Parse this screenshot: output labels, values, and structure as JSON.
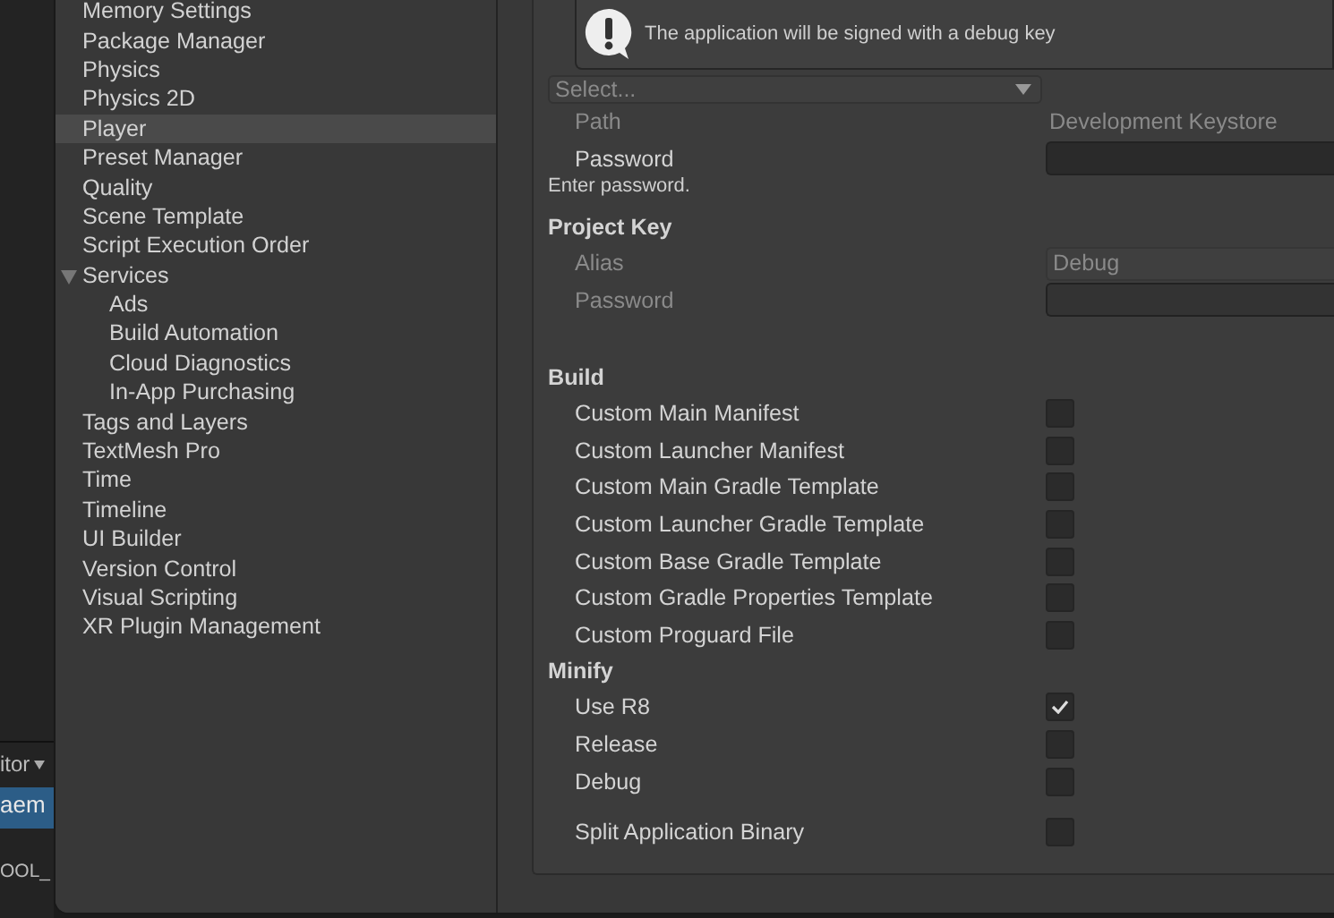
{
  "background_editor": {
    "dropdown_label": "itor",
    "selected_item": "aem",
    "item": "OOL_"
  },
  "sidebar": {
    "items": [
      {
        "label": "Memory Settings",
        "selected": false
      },
      {
        "label": "Package Manager",
        "selected": false
      },
      {
        "label": "Physics",
        "selected": false
      },
      {
        "label": "Physics 2D",
        "selected": false
      },
      {
        "label": "Player",
        "selected": true
      },
      {
        "label": "Preset Manager",
        "selected": false
      },
      {
        "label": "Quality",
        "selected": false
      },
      {
        "label": "Scene Template",
        "selected": false
      },
      {
        "label": "Script Execution Order",
        "selected": false
      },
      {
        "label": "Services",
        "selected": false,
        "expanded": true,
        "children": [
          {
            "label": "Ads",
            "selected": false
          },
          {
            "label": "Build Automation",
            "selected": false
          },
          {
            "label": "Cloud Diagnostics",
            "selected": false
          },
          {
            "label": "In-App Purchasing",
            "selected": false
          }
        ]
      },
      {
        "label": "Tags and Layers",
        "selected": false
      },
      {
        "label": "TextMesh Pro",
        "selected": false
      },
      {
        "label": "Time",
        "selected": false
      },
      {
        "label": "Timeline",
        "selected": false
      },
      {
        "label": "UI Builder",
        "selected": false
      },
      {
        "label": "Version Control",
        "selected": false
      },
      {
        "label": "Visual Scripting",
        "selected": false
      },
      {
        "label": "XR Plugin Management",
        "selected": false
      }
    ]
  },
  "publishing": {
    "alert": "The application will be signed with a debug key",
    "keystore_dropdown": {
      "value": "Select...",
      "disabled": true
    },
    "keystore_fields": [
      {
        "label": "Path",
        "value": "Development Keystore",
        "kind": "text",
        "disabled": true
      },
      {
        "label": "Password",
        "kind": "password",
        "disabled": false
      }
    ],
    "hint": "Enter password.",
    "project_key": {
      "heading": "Project Key",
      "fields": [
        {
          "label": "Alias",
          "value": "Debug",
          "kind": "dropdown",
          "disabled": true
        },
        {
          "label": "Password",
          "kind": "password",
          "disabled": true
        }
      ]
    },
    "sections": [
      {
        "heading": "Build",
        "options": [
          {
            "label": "Custom Main Manifest",
            "checked": false
          },
          {
            "label": "Custom Launcher Manifest",
            "checked": false
          },
          {
            "label": "Custom Main Gradle Template",
            "checked": false
          },
          {
            "label": "Custom Launcher Gradle Template",
            "checked": false
          },
          {
            "label": "Custom Base Gradle Template",
            "checked": false
          },
          {
            "label": "Custom Gradle Properties Template",
            "checked": false
          },
          {
            "label": "Custom Proguard File",
            "checked": false
          }
        ]
      },
      {
        "heading": "Minify",
        "options": [
          {
            "label": "Use R8",
            "checked": true
          },
          {
            "label": "Release",
            "checked": false
          },
          {
            "label": "Debug",
            "checked": false
          }
        ]
      }
    ],
    "split_binary": {
      "label": "Split Application Binary",
      "checked": false
    }
  }
}
